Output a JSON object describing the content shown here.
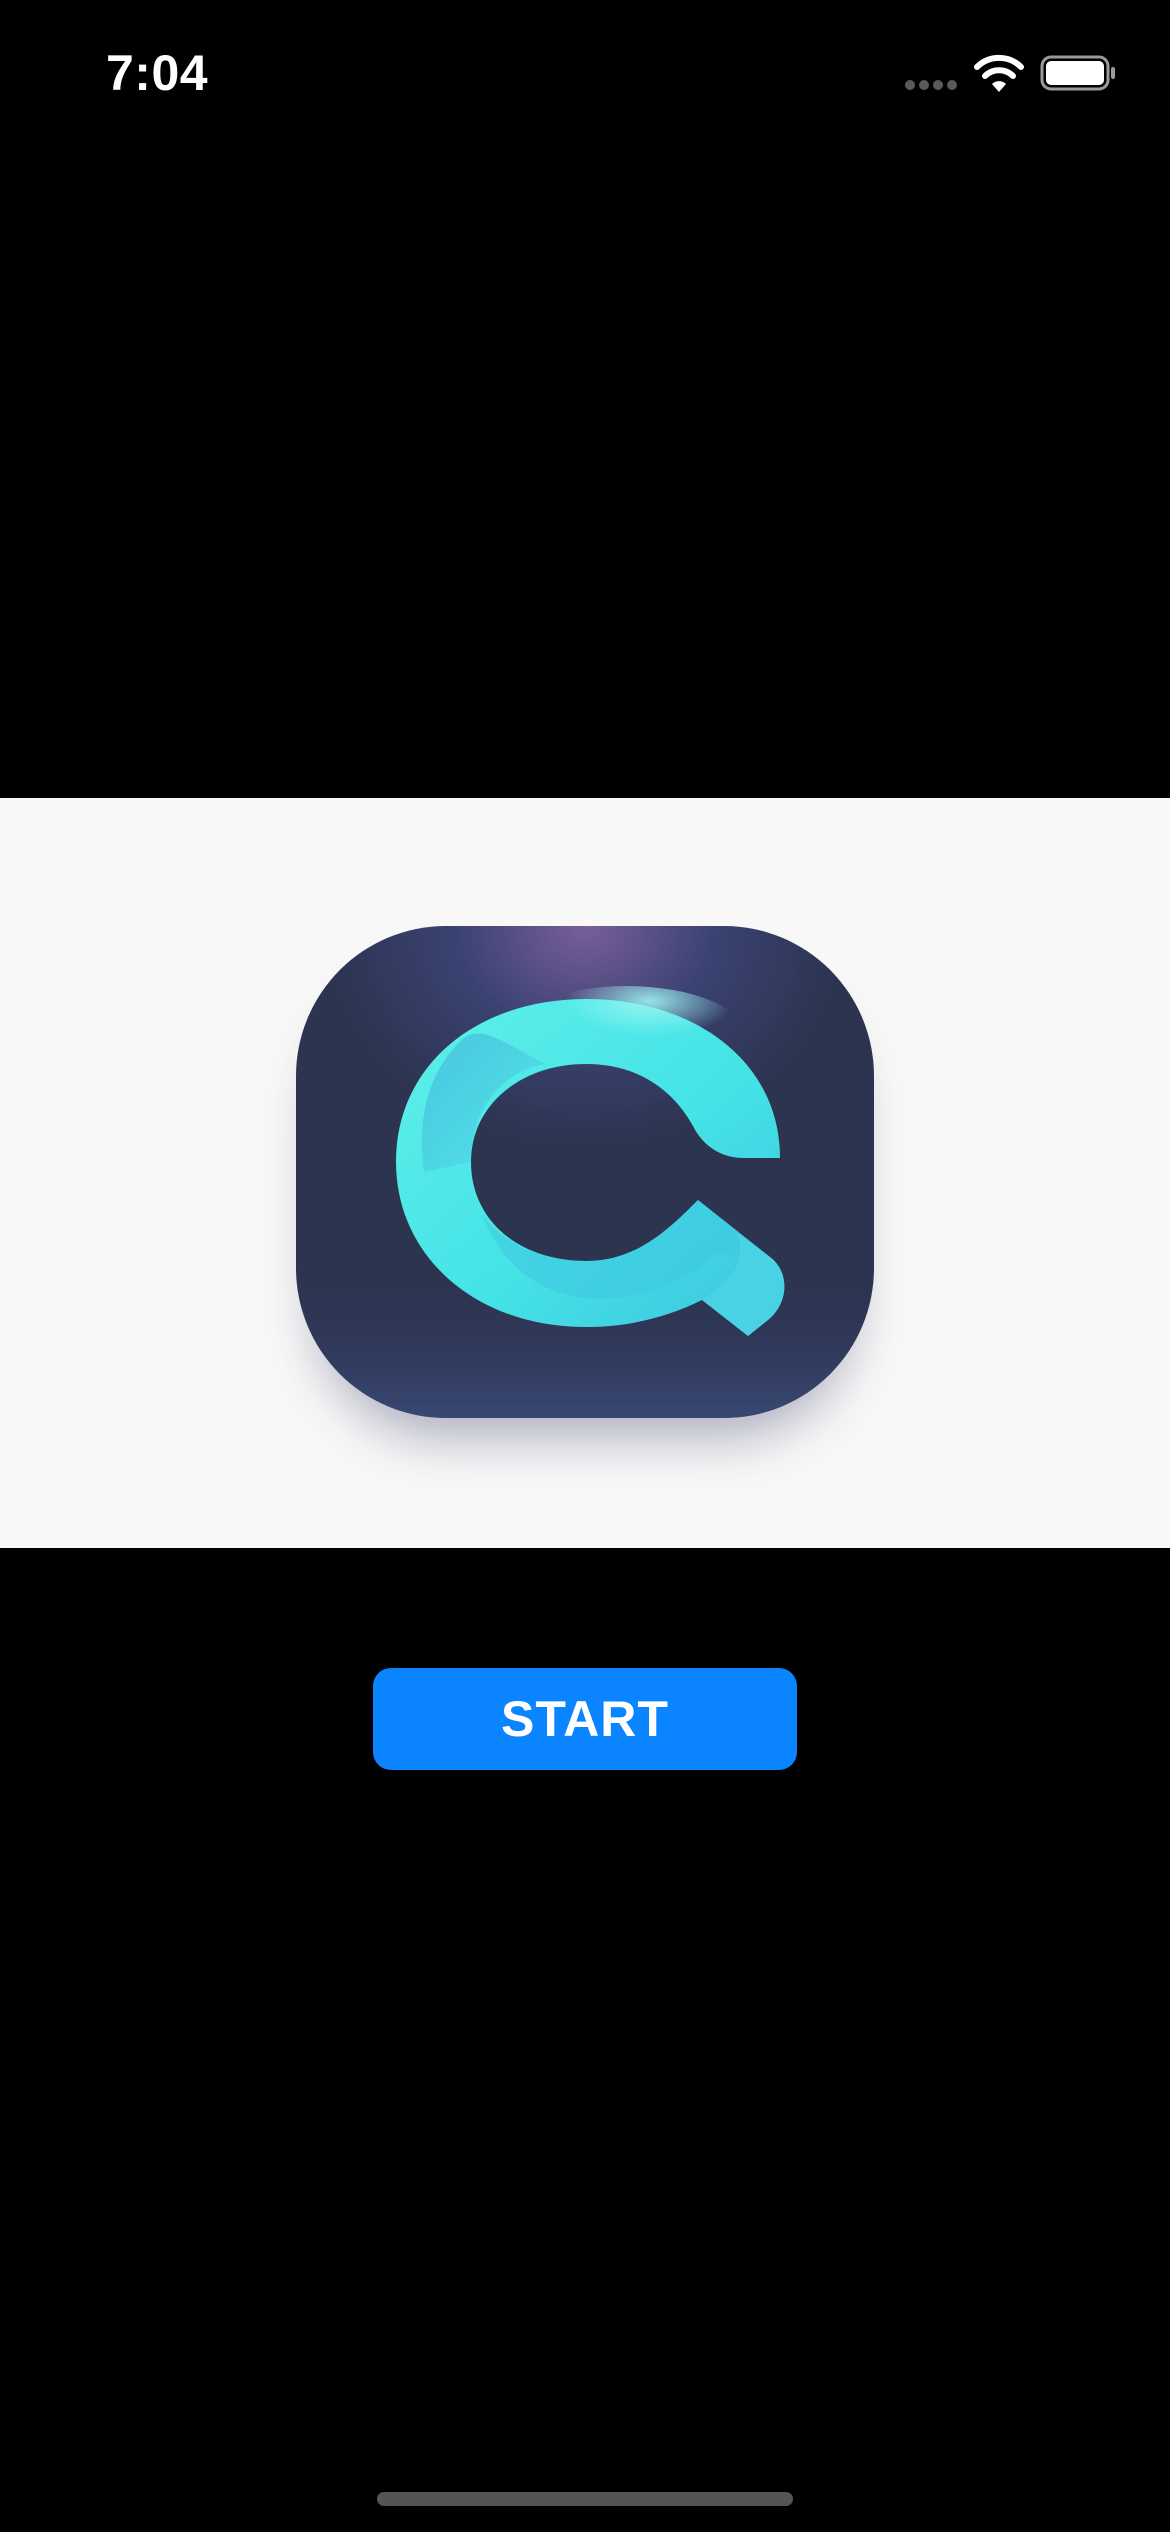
{
  "status_bar": {
    "time": "7:04",
    "signal_icon": "cellular-signal-icon",
    "wifi_icon": "wifi-icon",
    "battery_icon": "battery-icon"
  },
  "hero": {
    "logo_icon": "app-logo-icon",
    "colors": {
      "panel_background": "#f8f8f8",
      "icon_background": "#2b3350",
      "logo_accent": "#4ee8e4"
    }
  },
  "start_button": {
    "label": "START",
    "color": "#0a84ff"
  },
  "home_indicator": {
    "icon": "home-indicator"
  }
}
